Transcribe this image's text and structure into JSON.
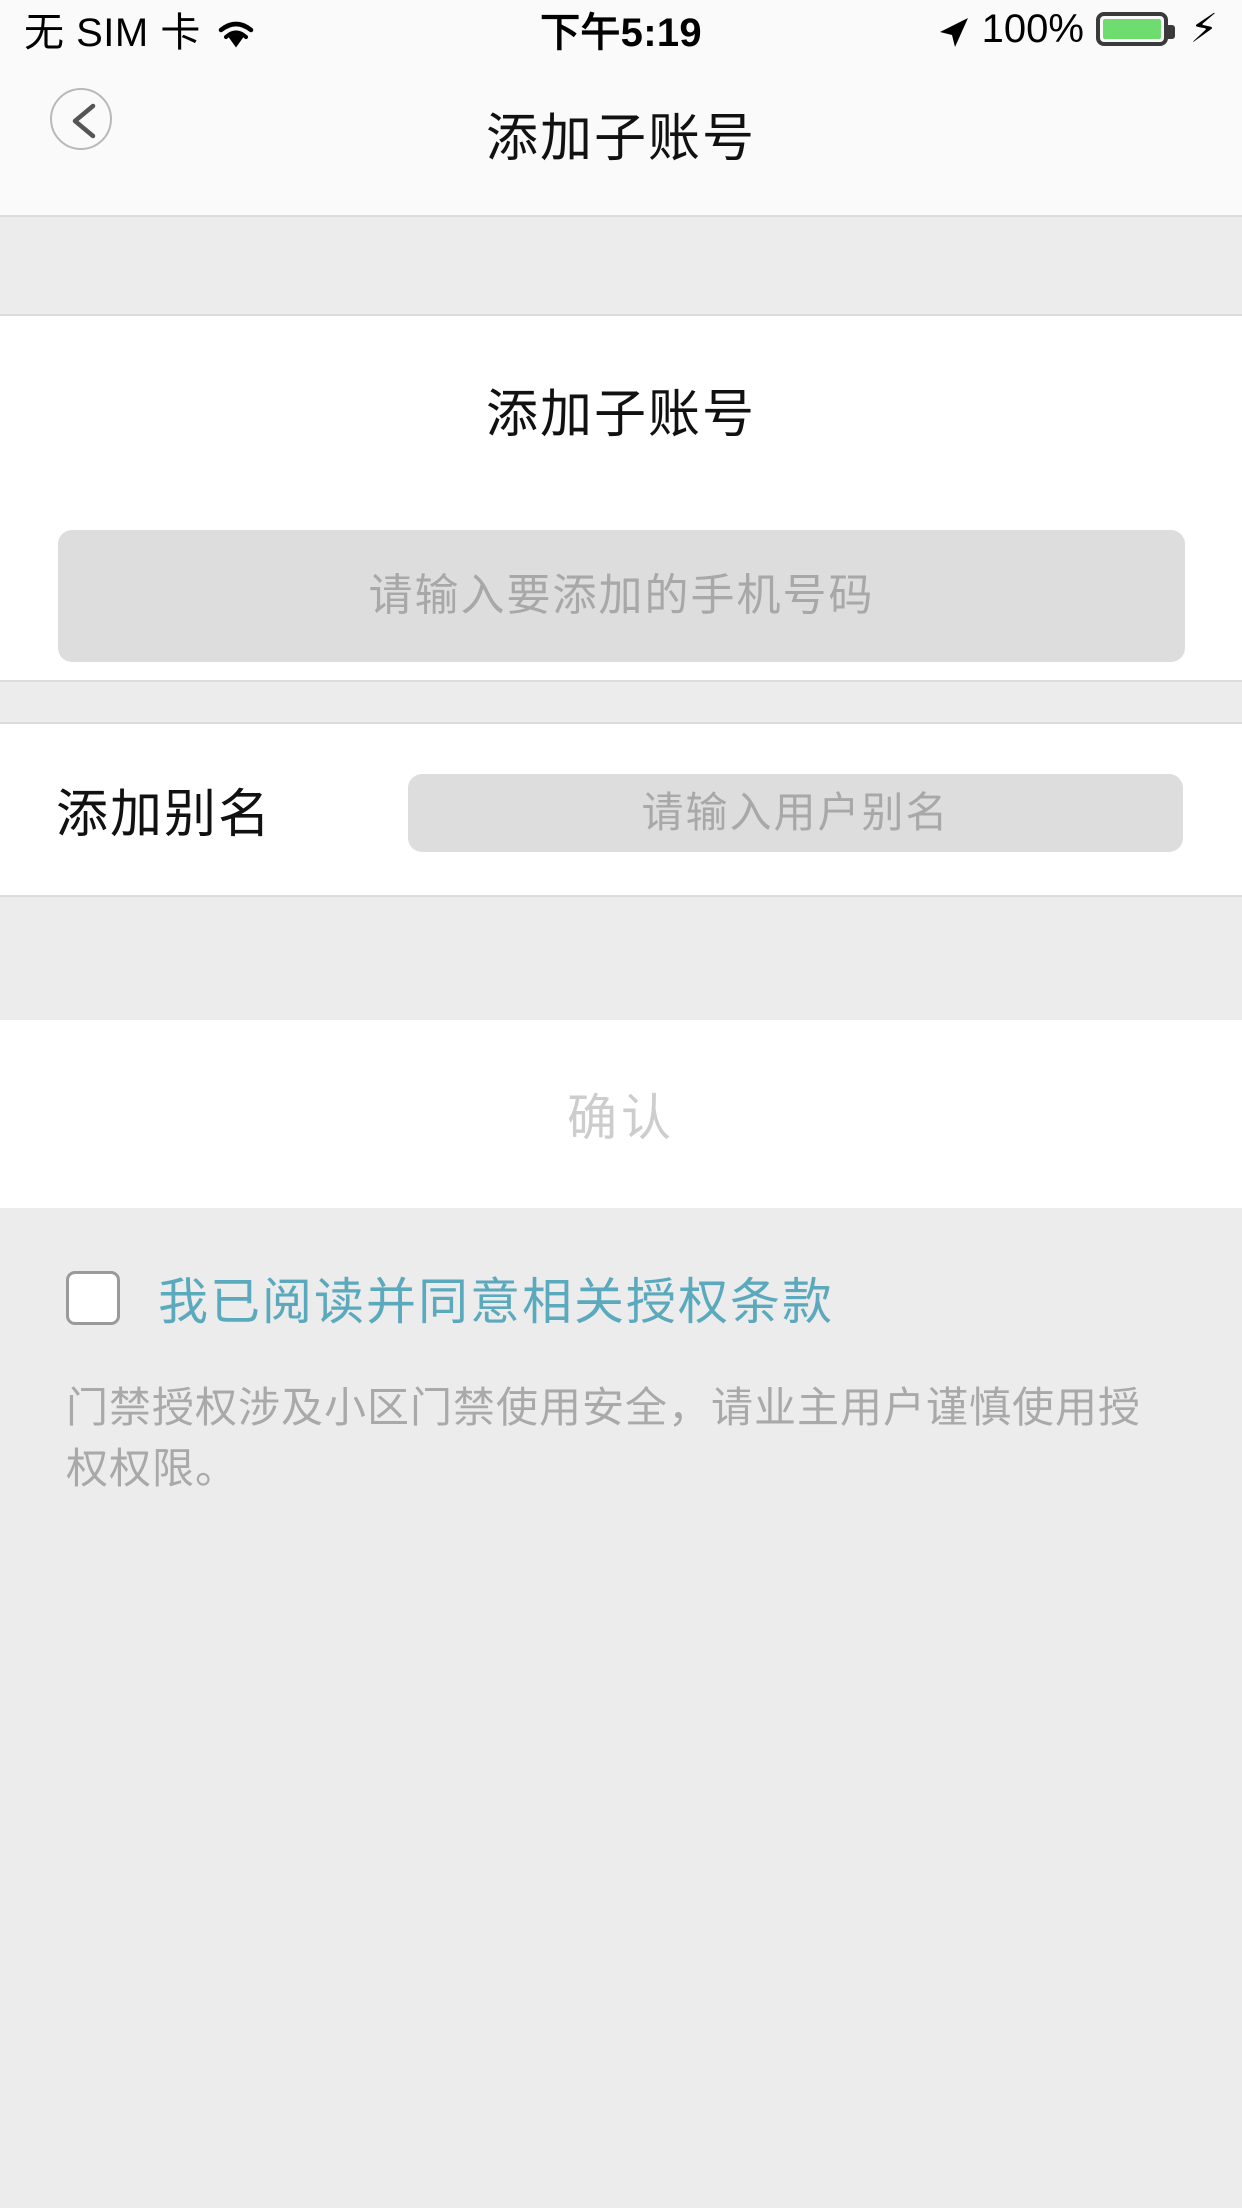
{
  "status_bar": {
    "carrier": "无 SIM 卡",
    "wifi_icon": "wifi-icon",
    "time": "下午5:19",
    "location_icon": "location-arrow-icon",
    "battery_percent": "100%",
    "battery_icon": "battery-full-icon",
    "charging_icon": "lightning-bolt-icon",
    "battery_color": "#6fdc6f"
  },
  "nav": {
    "back_icon": "chevron-left-icon",
    "title": "添加子账号"
  },
  "phone_card": {
    "heading": "添加子账号",
    "input_placeholder": "请输入要添加的手机号码",
    "input_value": ""
  },
  "alias_card": {
    "label": "添加别名",
    "input_placeholder": "请输入用户别名",
    "input_value": ""
  },
  "confirm": {
    "label": "确认",
    "disabled_color": "#cdcdcd"
  },
  "agreement": {
    "checkbox_name": "agreement-checkbox",
    "checked": false,
    "link_text": "我已阅读并同意相关授权条款",
    "link_color": "#5aa9bd",
    "description": "门禁授权涉及小区门禁使用安全，请业主用户谨慎使用授权权限。"
  }
}
